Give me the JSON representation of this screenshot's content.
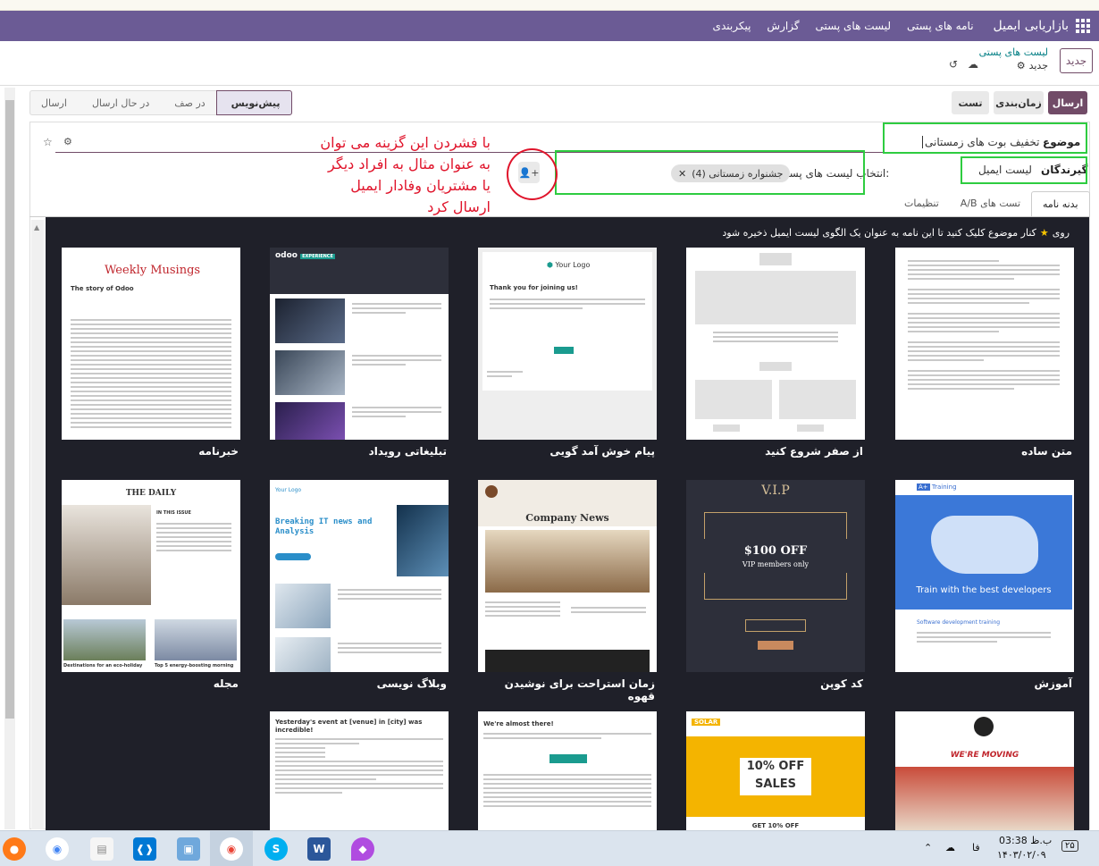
{
  "navbar": {
    "brand": "بازاریابی ایمیل",
    "menu": [
      "نامه های پستی",
      "لیست های پستی",
      "گزارش",
      "پیکربندی"
    ]
  },
  "control_panel": {
    "new_button": "جدید",
    "breadcrumb_parent": "لیست های پستی",
    "breadcrumb_current": "جدید"
  },
  "actions": {
    "send": "ارسال",
    "schedule": "زمان‌بندی",
    "test": "تست"
  },
  "stages": [
    "ارسال",
    "در حال ارسال",
    "در صف",
    "پیش‌نویس"
  ],
  "form": {
    "subject_label": "موضوع",
    "subject_value": "تخفیف بوت های زمستانی",
    "recipients_label": "گیرندگان",
    "recipients_value": "لیست ایمیل",
    "mailing_list_label": "انتخاب لیست های پستی:",
    "mailing_list_tag": "جشنواره زمستانی (4)"
  },
  "annotation": "با فشردن این گزینه می توان به عنوان مثال به افراد دیگر یا مشتریان وفادار ایمیل ارسال کرد",
  "tabs": [
    "بدنه نامه",
    "تست های A/B",
    "تنظیمات"
  ],
  "editor": {
    "tip_prefix": "روی",
    "tip_text": "کنار موضوع کلیک کنید تا این نامه به عنوان یک الگوی لیست ایمیل ذخیره شود",
    "templates": [
      {
        "name": "متن ساده"
      },
      {
        "name": "از صفر شروع کنید"
      },
      {
        "name": "پیام خوش آمد گویی"
      },
      {
        "name": "تبلیغاتی رویداد"
      },
      {
        "name": "خبرنامه"
      },
      {
        "name": "آموزش"
      },
      {
        "name": "کد کوپن"
      },
      {
        "name": "زمان استراحت برای نوشیدن قهوه"
      },
      {
        "name": "وبلاگ نویسی"
      },
      {
        "name": "مجله"
      }
    ],
    "preview_texts": {
      "weekly_title": "Weekly Musings",
      "weekly_sub": "The story of Odoo",
      "odoo_logo": "odoo",
      "your_logo": "Your Logo",
      "thanks": "Thank you for joining us!",
      "daily": "THE DAILY",
      "in_issue": "IN THIS ISSUE",
      "breaking": "Breaking IT news and Analysis",
      "company_news": "Company News",
      "vip": "V.I.P",
      "coupon": "$100 OFF",
      "vip_members": "VIP members only",
      "training": "Training",
      "train_best": "Train with the best developers",
      "sw_training": "Software development training",
      "yesterday": "Yesterday's event at [venue] in [city] was incredible!",
      "almost": "We're almost there!",
      "solar": "SOLAR",
      "ten_off": "10% OFF",
      "sales": "SALES",
      "get_ten": "GET 10% OFF",
      "moving": "WE'RE MOVING",
      "destinations": "Destinations for an eco-holiday",
      "energy": "Top 5 energy-boosting morning"
    }
  },
  "taskbar": {
    "time": "03:38 ب.ظ",
    "date": "۱۴۰۳/۰۲/۰۹",
    "lang": "فا",
    "notif": "۲۵"
  }
}
